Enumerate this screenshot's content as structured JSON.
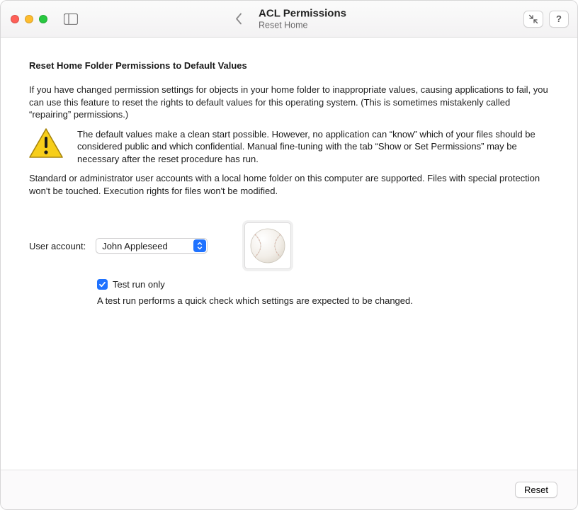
{
  "titlebar": {
    "title": "ACL Permissions",
    "subtitle": "Reset Home"
  },
  "content": {
    "heading": "Reset Home Folder Permissions to Default Values",
    "para1": "If you have changed permission settings for objects in your home folder to inappropriate values, causing applications to fail, you can use this feature to reset the rights to default values for this operating system. (This is sometimes mistakenly called “repairing” permissions.)",
    "warning_text": "The default values make a clean start possible. However, no application can “know” which of your files should be considered public and which confidential. Manual fine-tuning with the tab “Show or Set Permissions” may be necessary after the reset procedure has run.",
    "para2": "Standard or administrator user accounts with a local home folder on this computer are supported. Files with special protection won't be touched. Execution rights for files won't be modified.",
    "account_label": "User account:",
    "account_selected": "John Appleseed",
    "test_run_label": "Test run only",
    "test_run_checked": true,
    "test_run_hint": "A test run performs a quick check which settings are expected to be changed."
  },
  "footer": {
    "reset_label": "Reset"
  }
}
